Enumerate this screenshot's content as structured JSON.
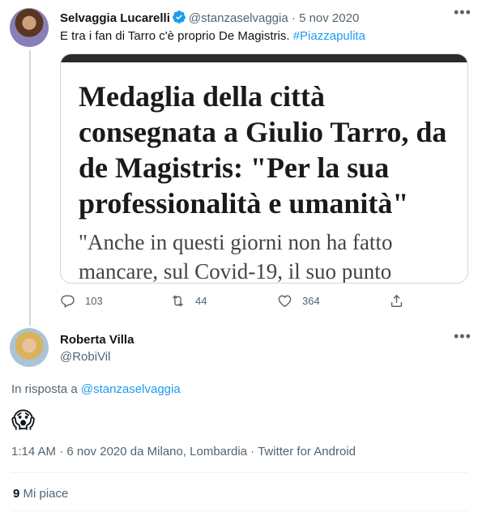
{
  "tweet1": {
    "display_name": "Selvaggia Lucarelli",
    "handle": "@stanzaselvaggia",
    "separator": "·",
    "date": "5 nov 2020",
    "text": "E tra i fan di Tarro c'è proprio De Magistris.",
    "hashtag": "#Piazzapulita",
    "media": {
      "headline": "Medaglia della città consegnata a Giulio Tarro, da de Magistris: \"Per la sua professionalità e umanità\"",
      "quote": "\"Anche in questi giorni non ha fatto mancare, sul Covid-19, il suo punto"
    },
    "actions": {
      "replies": "103",
      "retweets": "44",
      "likes": "364"
    }
  },
  "tweet2": {
    "display_name": "Roberta Villa",
    "handle": "@RobiVil",
    "reply_prefix": "In risposta a",
    "reply_to": "@stanzaselvaggia",
    "emoji": "😱",
    "meta": "1:14 AM · 6 nov 2020 da Milano, Lombardia · Twitter for Android",
    "likes_count": "9",
    "likes_label": "Mi piace"
  },
  "icons": {
    "more": "more-icon",
    "verified": "verified-badge-icon",
    "reply": "reply-icon",
    "retweet": "retweet-icon",
    "like": "heart-icon",
    "share": "share-icon"
  },
  "colors": {
    "accent": "#1d9bf0",
    "muted_text": "#536471",
    "border": "#cfd9de"
  }
}
